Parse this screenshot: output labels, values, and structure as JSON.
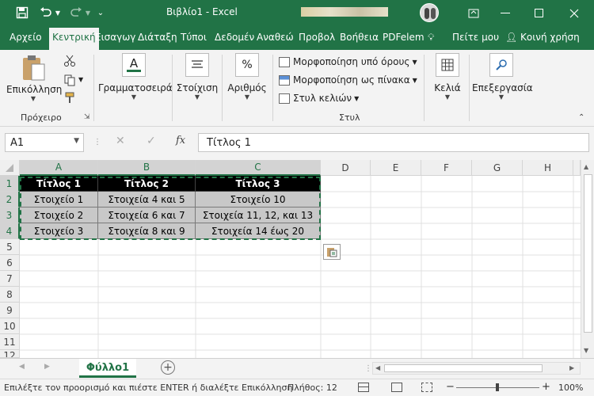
{
  "window": {
    "title": "Βιβλίο1 - Excel"
  },
  "tabs": [
    "Αρχείο",
    "Κεντρική",
    "Εισαγωγή",
    "Διάταξη",
    "Τύποι",
    "Δεδομένα",
    "Αναθεώρηση",
    "Προβολή",
    "Βοήθεια",
    "PDFelement"
  ],
  "tab_display": [
    "Αρχείο",
    "Κεντρική",
    "Εισαγωγ",
    "Διάταξη",
    "Τύποι",
    "Δεδομέν",
    "Αναθεώ",
    "Προβολ",
    "Βοήθεια",
    "PDFelem"
  ],
  "tell_me": "Πείτε μου",
  "share": "Κοινή χρήση",
  "ribbon": {
    "paste": "Επικόλληση",
    "clipboard_label": "Πρόχειρο",
    "font": "Γραμματοσειρά",
    "alignment": "Στοίχιση",
    "number": "Αριθμός",
    "conditional": "Μορφοποίηση υπό όρους",
    "format_table": "Μορφοποίηση ως πίνακα",
    "cell_styles": "Στυλ κελιών",
    "styles_label": "Στυλ",
    "cells": "Κελιά",
    "editing": "Επεξεργασία"
  },
  "formula_bar": {
    "name_box": "A1",
    "content": "Τίτλος 1",
    "fx": "fx"
  },
  "columns": [
    "A",
    "B",
    "C",
    "D",
    "E",
    "F",
    "G",
    "H"
  ],
  "rows": [
    "1",
    "2",
    "3",
    "4",
    "5",
    "6",
    "7",
    "8",
    "9",
    "10",
    "11",
    "12"
  ],
  "table": {
    "headers": [
      "Τίτλος 1",
      "Τίτλος 2",
      "Τίτλος 3"
    ],
    "rows": [
      [
        "Στοιχείο 1",
        "Στοιχεία 4 και 5",
        "Στοιχείο 10"
      ],
      [
        "Στοιχείο 2",
        "Στοιχεία 6 και 7",
        "Στοιχεία 11, 12, και 13"
      ],
      [
        "Στοιχείο 3",
        "Στοιχεία 8 και 9",
        "Στοιχεία 14 έως 20"
      ]
    ]
  },
  "sheet_tab": "Φύλλο1",
  "status": {
    "message": "Επιλέξτε τον προορισμό και πιέστε ENTER ή διαλέξτε Επικόλληση",
    "count": "Πλήθος: 12",
    "zoom": "100%"
  },
  "colors": {
    "accent": "#217346",
    "header_bg": "#000000",
    "data_bg": "#c8c8c8"
  }
}
